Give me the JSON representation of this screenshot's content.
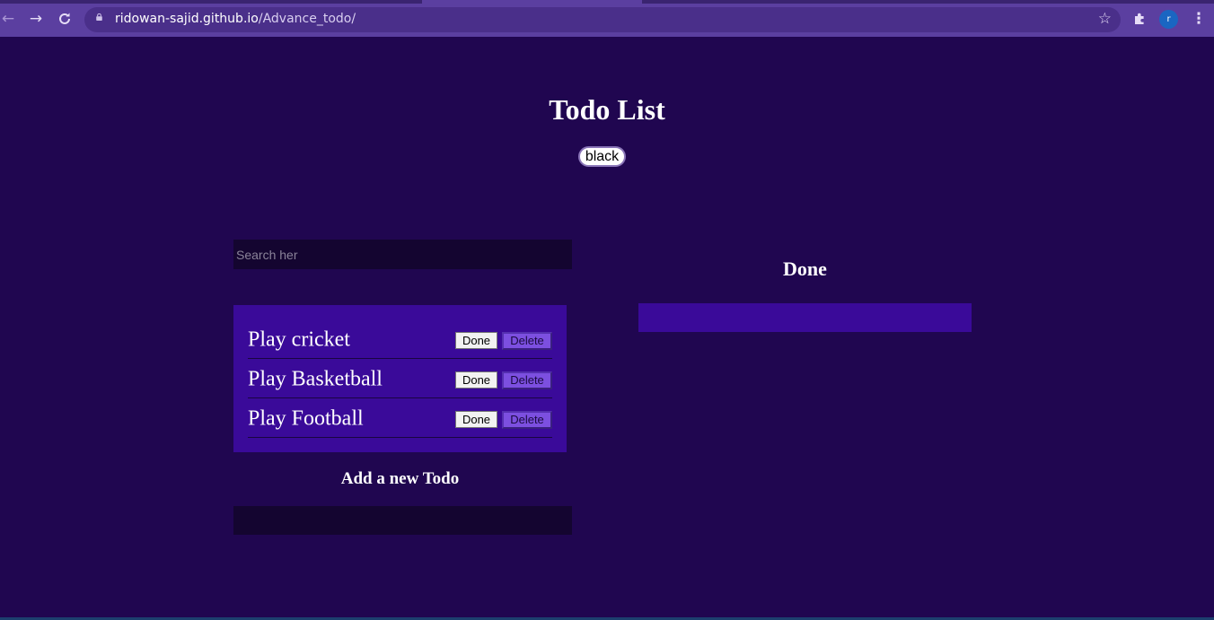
{
  "browser": {
    "url_host": "ridowan-sajid.github.io",
    "url_path": "/Advance_todo/",
    "profile_initial": "r",
    "icons": {
      "back": "back-arrow-icon",
      "forward": "forward-arrow-icon",
      "reload": "reload-icon",
      "lock": "lock-icon",
      "bookmark": "star-icon",
      "extensions": "puzzle-icon",
      "menu": "kebab-menu-icon"
    }
  },
  "page": {
    "title": "Todo List",
    "theme_button_label": "black",
    "search_placeholder": "Search her",
    "todos": [
      {
        "text": "Play cricket",
        "done_label": "Done",
        "delete_label": "Delete"
      },
      {
        "text": "Play Basketball",
        "done_label": "Done",
        "delete_label": "Delete"
      },
      {
        "text": "Play Football",
        "done_label": "Done",
        "delete_label": "Delete"
      }
    ],
    "add_heading": "Add a new Todo",
    "add_input_value": "",
    "done_heading": "Done",
    "done_items": []
  },
  "colors": {
    "background": "#200650",
    "panel": "#3a0a99",
    "input_bg": "#140530",
    "delete_button": "#7c4fe0",
    "browser_chrome": "#5b3fa0"
  }
}
